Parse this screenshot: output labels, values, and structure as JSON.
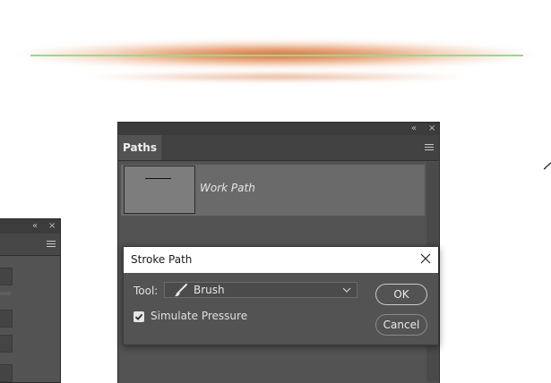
{
  "paths_panel": {
    "tab_label": "Paths",
    "path_name": "Work Path"
  },
  "stroke_dialog": {
    "title": "Stroke Path",
    "tool_label": "Tool:",
    "tool_value": "Brush",
    "simulate_pressure_label": "Simulate Pressure",
    "simulate_pressure_checked": true,
    "ok_label": "OK",
    "cancel_label": "Cancel"
  },
  "colors": {
    "panel_bg": "#535353",
    "panel_header": "#3c3c3c",
    "selected_row": "#6a6a6a",
    "path_line": "#8ce08c",
    "glow": "#d4682c"
  }
}
